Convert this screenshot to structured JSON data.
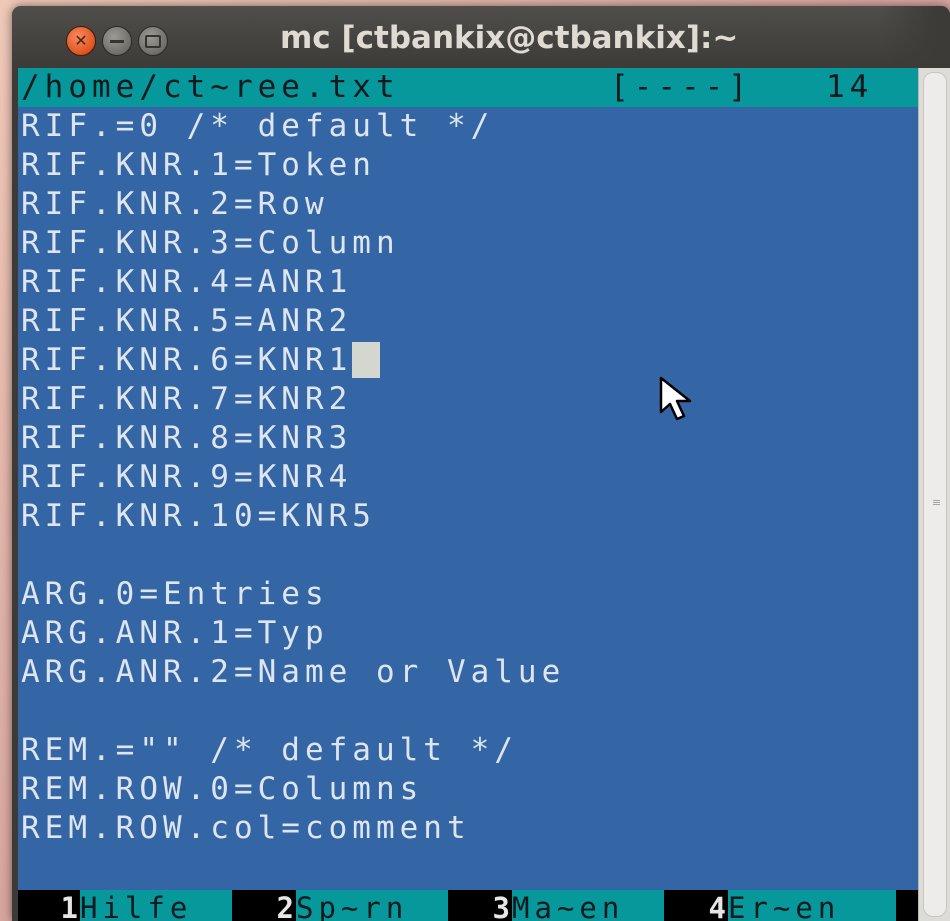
{
  "window": {
    "title": "mc [ctbankix@ctbankix]:~",
    "title_bar_color": "#3c3b37",
    "buttons": [
      {
        "name": "close",
        "icon": "close-icon",
        "color": "#e0531f"
      },
      {
        "name": "minimize",
        "icon": "minimize-icon"
      },
      {
        "name": "maximize",
        "icon": "maximize-icon"
      }
    ]
  },
  "editor": {
    "status": {
      "path": "/home/ct~ree.txt",
      "flags": "[----]",
      "column": "14"
    },
    "lines": [
      "RIF.=0 /* default */",
      "RIF.KNR.1=Token",
      "RIF.KNR.2=Row",
      "RIF.KNR.3=Column",
      "RIF.KNR.4=ANR1",
      "RIF.KNR.5=ANR2",
      "RIF.KNR.6=KNR1",
      "RIF.KNR.7=KNR2",
      "RIF.KNR.8=KNR3",
      "RIF.KNR.9=KNR4",
      "RIF.KNR.10=KNR5",
      "",
      "ARG.0=Entries",
      "ARG.ANR.1=Typ",
      "ARG.ANR.2=Name or Value",
      "",
      "REM.=\"\" /* default */",
      "REM.ROW.0=Columns",
      "REM.ROW.col=comment"
    ],
    "cursor_line": 7,
    "background_color": "#3465a4",
    "text_color": "#dee5ef",
    "status_bar_color": "#06989a"
  },
  "function_keys": [
    {
      "num": "1",
      "label": "Hilfe"
    },
    {
      "num": "2",
      "label": "Sp~rn"
    },
    {
      "num": "3",
      "label": "Ma~en"
    },
    {
      "num": "4",
      "label": "Er~en"
    }
  ],
  "icons": {
    "mouse_pointer": "arrow-pointer-icon",
    "scrollbar_grip": "scroll-grip-icon"
  }
}
